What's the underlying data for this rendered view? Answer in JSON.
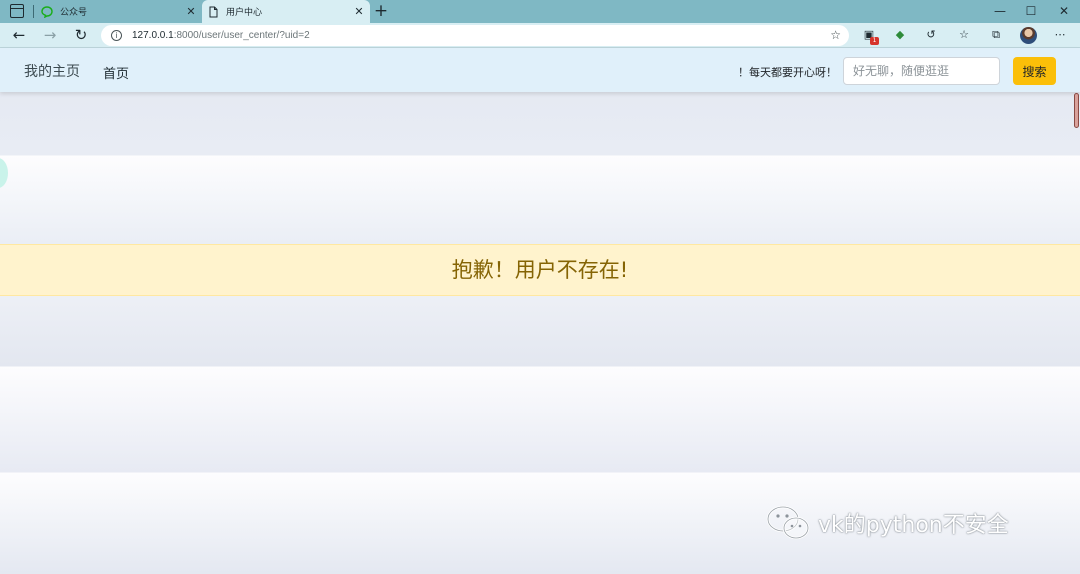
{
  "browser": {
    "tabs": [
      {
        "title": "公众号",
        "icon": "wechat-pay-icon",
        "active": false
      },
      {
        "title": "用户中心",
        "icon": "page-icon",
        "active": true
      }
    ],
    "address": {
      "host": "127.0.0.1",
      "path": ":8000/user/user_center/?uid=2"
    },
    "extension_badge": "1",
    "window_controls": [
      "minimize",
      "maximize",
      "close"
    ]
  },
  "navbar": {
    "brand": "我的主页",
    "home_link": "首页",
    "motto": "！每天都要开心呀！",
    "search": {
      "placeholder": "好无聊，随便逛逛",
      "value": ""
    },
    "search_button": "搜索"
  },
  "alert": {
    "message": "抱歉！用户不存在!",
    "bg_color": "#fff3cd",
    "text_color": "#856404"
  },
  "watermark": {
    "text": "vk的python不安全"
  }
}
